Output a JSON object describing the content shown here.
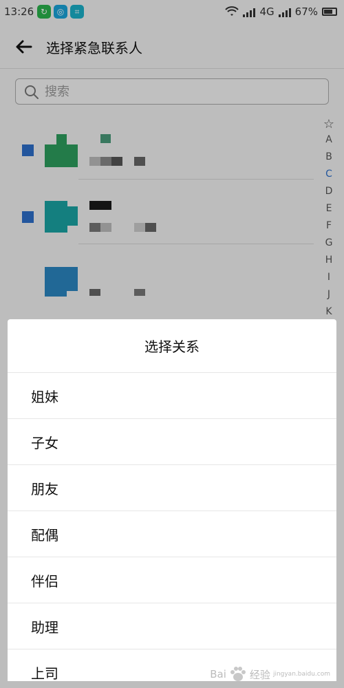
{
  "status_bar": {
    "time": "13:26",
    "network": "4G",
    "battery": "67%",
    "apps": [
      {
        "icon": "wechat-sync-icon",
        "color": "#2bb24c"
      },
      {
        "icon": "browser-icon",
        "color": "#1aa3d9"
      },
      {
        "icon": "scan-icon",
        "color": "#1bb0c8"
      }
    ]
  },
  "header": {
    "title": "选择紧急联系人"
  },
  "search": {
    "placeholder": "搜索"
  },
  "contacts": [
    {
      "checked": true,
      "avatar_color": "#2e9e5e"
    },
    {
      "checked": true,
      "avatar_color": "#1aa3a3"
    },
    {
      "checked": false,
      "avatar_color": "#2b86c0"
    }
  ],
  "index_bar": {
    "items": [
      "☆",
      "A",
      "B",
      "C",
      "D",
      "E",
      "F",
      "G",
      "H",
      "I",
      "J",
      "K"
    ],
    "active": "C"
  },
  "sheet": {
    "title": "选择关系",
    "options": [
      "姐妹",
      "子女",
      "朋友",
      "配偶",
      "伴侣",
      "助理",
      "上司"
    ]
  },
  "watermark": {
    "text": "Bai",
    "suffix": "经验",
    "url": "jingyan.baidu.com"
  },
  "colors": {
    "accent": "#2d6fc9",
    "overlay": "rgba(0,0,0,0.22)"
  }
}
